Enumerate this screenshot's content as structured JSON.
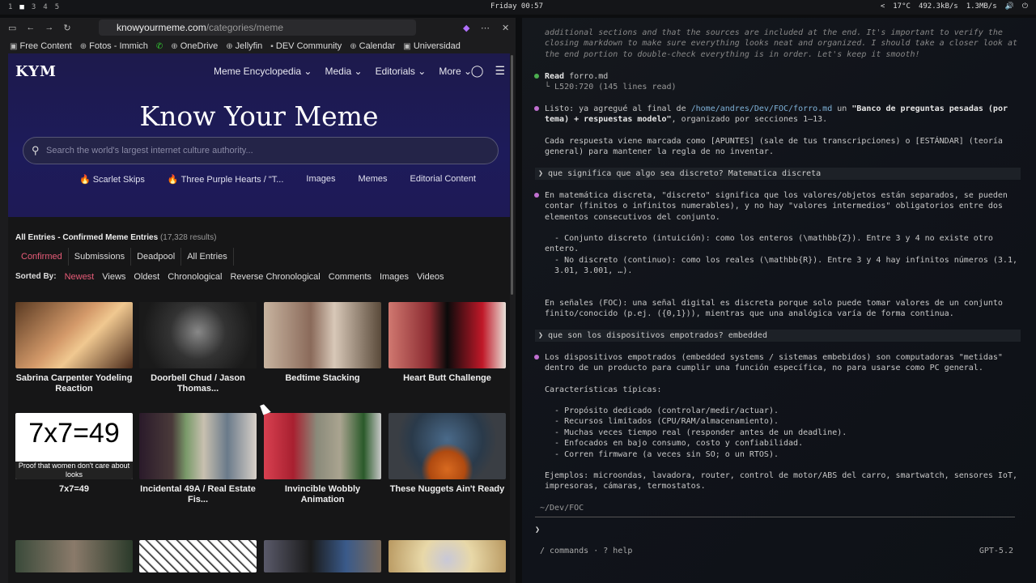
{
  "topbar": {
    "workspaces": [
      "1",
      "2",
      "3",
      "4",
      "5"
    ],
    "active_workspace": "2",
    "clock": "Friday 00:57",
    "tray": [
      "<",
      "17°C",
      "492.3kB/s",
      "1.3MB/s"
    ]
  },
  "browser": {
    "url_host": "knowyourmeme.com",
    "url_path": "/categories/meme",
    "bookmarks": [
      "Free Content",
      "Fotos - Immich",
      "OneDrive",
      "Jellyfin",
      "DEV Community",
      "Calendar",
      "Universidad"
    ]
  },
  "site": {
    "logo": "KYM",
    "nav": [
      "Meme Encyclopedia",
      "Media",
      "Editorials",
      "More"
    ],
    "title": "Know Your Meme",
    "search_placeholder": "Search the world's largest internet culture authority...",
    "hero_links": [
      "Scarlet Skips",
      "Three Purple Hearts / \"T...",
      "Images",
      "Memes",
      "Editorial Content"
    ],
    "entries_title": "All Entries - Confirmed Meme Entries",
    "entries_count": "(17,328 results)",
    "filter_tabs": [
      "Confirmed",
      "Submissions",
      "Deadpool",
      "All Entries"
    ],
    "sort_label": "Sorted By:",
    "sort_options": [
      "Newest",
      "Views",
      "Oldest",
      "Chronological",
      "Reverse Chronological",
      "Comments",
      "Images",
      "Videos"
    ],
    "cards": [
      {
        "title": "Sabrina Carpenter Yodeling Reaction",
        "color": "#8a5a3a"
      },
      {
        "title": "Doorbell Chud / Jason Thomas...",
        "color": "#3a3a3a"
      },
      {
        "title": "Bedtime Stacking",
        "color": "#a08070"
      },
      {
        "title": "Heart Butt Challenge",
        "color": "#b0202a"
      },
      {
        "title": "7x7=49",
        "color": "#ffffff"
      },
      {
        "title": "Incidental 49A / Real Estate Fis...",
        "color": "#4a5a6a"
      },
      {
        "title": "Invincible Wobbly Animation",
        "color": "#aa2a3a"
      },
      {
        "title": "These Nuggets Ain't Ready",
        "color": "#555a60"
      }
    ],
    "card8_text": "7x7=49",
    "card8_sub": "Proof that women don't care about looks"
  },
  "terminal": {
    "intro": "additional sections and that the sources are included at the end. It's important to verify the closing markdown to make sure everything looks neat and organized. I should take a closer look at the end portion to double-check everything is in order. Let's keep it smooth!",
    "read_label": "Read",
    "read_file": "forro.md",
    "read_detail": "L520:720 (145 lines read)",
    "msg1_a": "Listo: ya agregué al final de ",
    "msg1_path": "/home/andres/Dev/FOC/forro.md",
    "msg1_b": " un ",
    "msg1_bold": "\"Banco de preguntas pesadas (por tema) + respuestas modelo\"",
    "msg1_c": ", organizado por secciones 1–13.",
    "msg2": "Cada respuesta viene marcada como [APUNTES] (sale de tus transcripciones) o [ESTÁNDAR] (teoría general) para mantener la regla de no inventar.",
    "q1": "❯ que significa que algo sea discreto? Matematica discreta",
    "a1": "En matemática discreta, \"discreto\" significa que los valores/objetos están separados, se pueden contar (finitos o infinitos numerables), y no hay \"valores intermedios\" obligatorios entre dos elementos consecutivos del conjunto.",
    "a1_l1": "  - Conjunto discreto (intuición): como los enteros (\\mathbb{Z}). Entre 3 y 4 no existe otro entero.",
    "a1_l2": "  - No discreto (continuo): como los reales (\\mathbb{R}). Entre 3 y 4 hay infinitos números (3.1,\n  3.01, 3.001, …).",
    "a1_l3": "En señales (FOC): una señal digital es discreta porque solo puede tomar valores de un conjunto finito/conocido (p.ej. ({0,1})), mientras que una analógica varía de forma continua.",
    "q2": "❯ que son los dispositivos empotrados? embedded",
    "a2": "Los dispositivos empotrados (embedded systems / sistemas embebidos) son computadoras \"metidas\" dentro de un producto para cumplir una función específica, no para usarse como PC general.",
    "a2_h": "Características típicas:",
    "a2_list": "  - Propósito dedicado (controlar/medir/actuar).\n  - Recursos limitados (CPU/RAM/almacenamiento).\n  - Muchas veces tiempo real (responder antes de un deadline).\n  - Enfocados en bajo consumo, costo y confiabilidad.\n  - Corren firmware (a veces sin SO; o un RTOS).",
    "a2_ex": "Ejemplos: microondas, lavadora, router, control de motor/ABS del carro, smartwatch, sensores IoT, impresoras, cámaras, termostatos.",
    "cwd": "~/Dev/FOC",
    "prompt": "❯",
    "bottom_hint": "/ commands · ? help",
    "model": "GPT-5.2"
  }
}
